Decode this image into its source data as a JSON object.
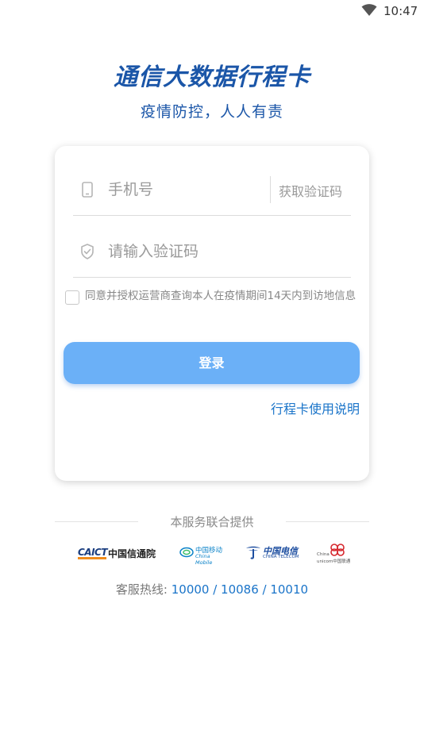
{
  "status_bar": {
    "time": "10:47",
    "wifi_icon": "wifi-icon"
  },
  "header": {
    "title": "通信大数据行程卡",
    "subtitle": "疫情防控，人人有责"
  },
  "form": {
    "phone_placeholder": "手机号",
    "phone_icon": "phone-icon",
    "get_code_label": "获取验证码",
    "code_placeholder": "请输入验证码",
    "code_icon": "shield-icon",
    "agreement_checked": false,
    "agreement_text": "同意并授权运营商查询本人在疫情期间14天内到访地信息",
    "login_label": "登录",
    "guide_link": "行程卡使用说明"
  },
  "providers": {
    "label": "本服务联合提供",
    "caict": {
      "mark": "CAICT",
      "name": "中国信通院"
    },
    "china_mobile": {
      "cn": "中国移动",
      "en": "China Mobile"
    },
    "china_telecom": {
      "cn": "中国电信",
      "en": "CHINA TELECOM"
    },
    "china_unicom": {
      "en1": "China",
      "en2": "unicom中国联通"
    }
  },
  "hotline": {
    "label": "客服热线: ",
    "numbers": "10000 / 10086 / 10010"
  },
  "colors": {
    "brand_blue": "#1b56a8",
    "button_blue": "#6bb0f7",
    "link_blue": "#1a74c9"
  }
}
